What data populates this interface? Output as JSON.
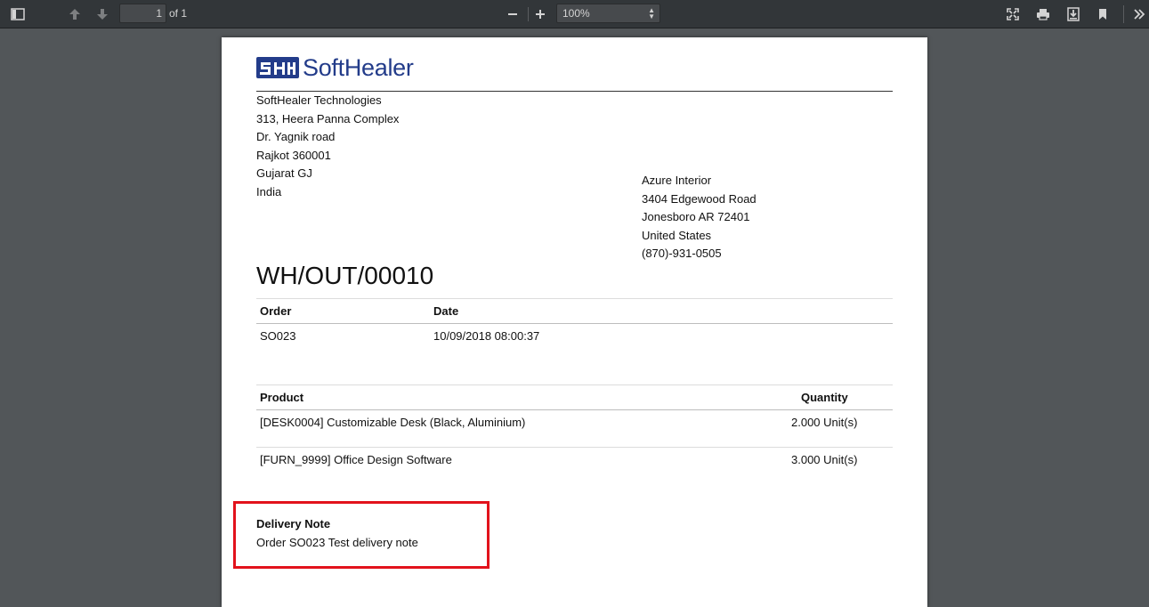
{
  "toolbar": {
    "page_number": "1",
    "page_count_label": "of 1",
    "zoom": "100%",
    "icons": [
      "sidebar-toggle-icon",
      "previous-page-icon",
      "next-page-icon",
      "zoom-out-icon",
      "zoom-in-icon",
      "fullscreen-icon",
      "print-icon",
      "download-icon",
      "bookmark-icon",
      "tools-icon"
    ]
  },
  "document": {
    "logo_text": "SoftHealer",
    "company_address": [
      "SoftHealer Technologies",
      "313, Heera Panna Complex",
      "Dr. Yagnik road",
      "Rajkot 360001",
      "Gujarat GJ",
      "India"
    ],
    "customer_address": [
      "Azure Interior",
      "3404 Edgewood Road",
      "Jonesboro AR 72401",
      "United States",
      "(870)-931-0505"
    ],
    "title": "WH/OUT/00010",
    "info_table": {
      "headers": [
        "Order",
        "Date"
      ],
      "row": [
        "SO023",
        "10/09/2018 08:00:37"
      ]
    },
    "product_table": {
      "headers": [
        "Product",
        "Quantity"
      ],
      "rows": [
        [
          "[DESK0004] Customizable Desk (Black, Aluminium)",
          "2.000 Unit(s)"
        ],
        [
          "[FURN_9999] Office Design Software",
          "3.000 Unit(s)"
        ]
      ]
    },
    "delivery_note": {
      "label": "Delivery Note",
      "text": "Order SO023 Test delivery note"
    }
  },
  "colors": {
    "toolbar_bg": "#323639",
    "viewer_bg": "#525659",
    "logo_blue": "#233c8a",
    "highlight_red": "#e2121c"
  }
}
